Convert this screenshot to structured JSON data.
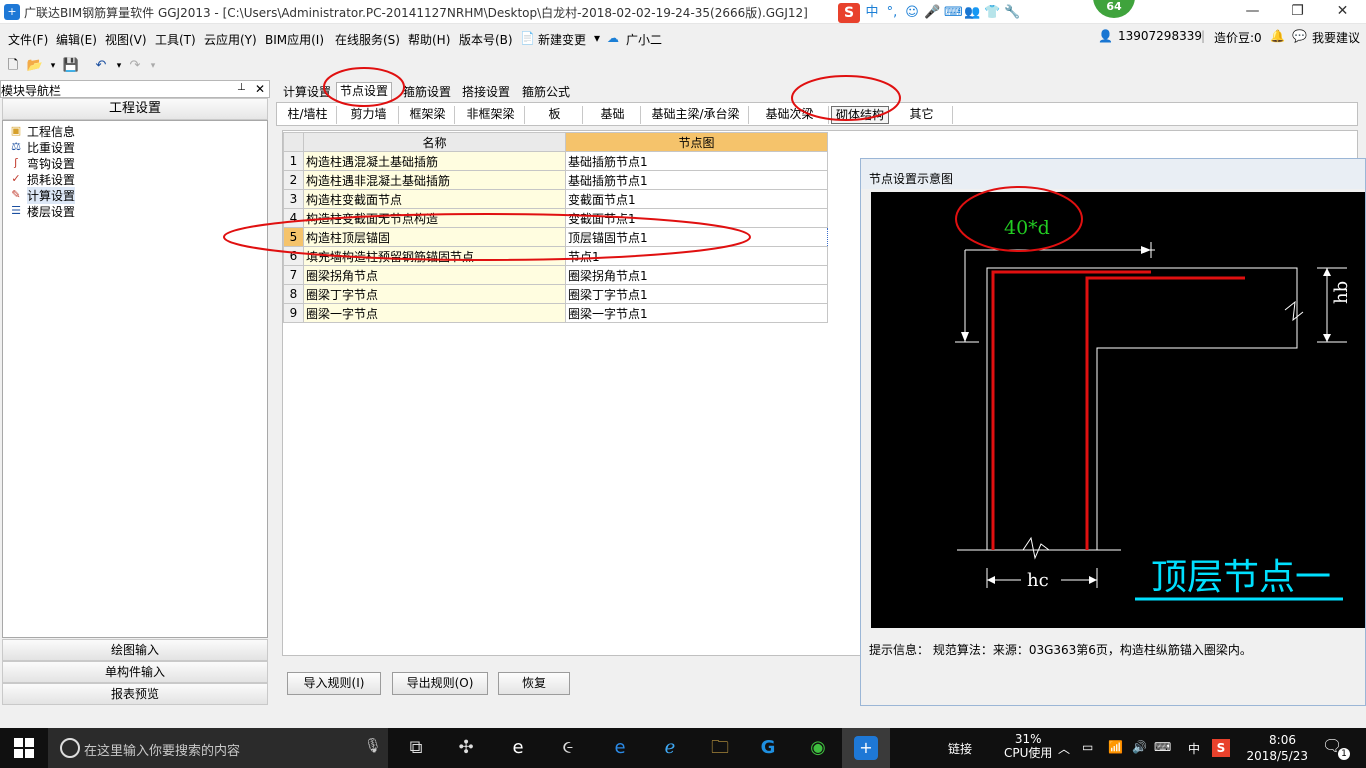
{
  "window": {
    "title": "广联达BIM钢筋算量软件 GGJ2013 - [C:\\Users\\Administrator.PC-20141127NRHM\\Desktop\\白龙村-2018-02-02-19-24-35(2666版).GGJ12]",
    "ime_logo": "S",
    "ime_mode": "中",
    "badge": "64"
  },
  "menu": {
    "items": [
      "文件(F)",
      "编辑(E)",
      "视图(V)",
      "工具(T)",
      "云应用(Y)",
      "BIM应用(I)",
      "在线服务(S)",
      "帮助(H)",
      "版本号(B)",
      "新建变更",
      "广小二"
    ],
    "phone": "13907298339",
    "price_beans": "造价豆:0",
    "suggest": "我要建议"
  },
  "nav": {
    "header": "模块导航栏",
    "pin": "📌",
    "close": "✕",
    "title": "工程设置",
    "tree": [
      {
        "label": "工程信息",
        "icon": "project-info-icon"
      },
      {
        "label": "比重设置",
        "icon": "density-icon"
      },
      {
        "label": "弯钩设置",
        "icon": "hook-icon"
      },
      {
        "label": "损耗设置",
        "icon": "loss-icon"
      },
      {
        "label": "计算设置",
        "icon": "calc-icon"
      },
      {
        "label": "楼层设置",
        "icon": "floor-icon"
      }
    ],
    "bottom": [
      "绘图输入",
      "单构件输入",
      "报表预览"
    ]
  },
  "tabs": [
    "计算设置",
    "节点设置",
    "箍筋设置",
    "搭接设置",
    "箍筋公式"
  ],
  "subtabs": [
    "柱/墙柱",
    "剪力墙",
    "框架梁",
    "非框架梁",
    "板",
    "基础",
    "基础主梁/承台梁",
    "基础次梁",
    "砌体结构",
    "其它"
  ],
  "grid": {
    "headers": [
      "名称",
      "节点图"
    ],
    "rows": [
      {
        "n": "1",
        "name": "构造柱遇混凝土基础插筋",
        "node": "基础插筋节点1"
      },
      {
        "n": "2",
        "name": "构造柱遇非混凝土基础插筋",
        "node": "基础插筋节点1"
      },
      {
        "n": "3",
        "name": "构造柱变截面节点",
        "node": "变截面节点1"
      },
      {
        "n": "4",
        "name": "构造柱变截面无节点构造",
        "node": "变截面节点1"
      },
      {
        "n": "5",
        "name": "构造柱顶层锚固",
        "node": "顶层锚固节点1"
      },
      {
        "n": "6",
        "name": "填充墙构造柱预留钢筋锚固节点",
        "node": "节点1"
      },
      {
        "n": "7",
        "name": "圈梁拐角节点",
        "node": "圈梁拐角节点1"
      },
      {
        "n": "8",
        "name": "圈梁丁字节点",
        "node": "圈梁丁字节点1"
      },
      {
        "n": "9",
        "name": "圈梁一字节点",
        "node": "圈梁一字节点1"
      }
    ]
  },
  "buttons": {
    "import": "导入规则(I)",
    "export": "导出规则(O)",
    "restore": "恢复"
  },
  "dialog": {
    "title": "节点设置示意图",
    "label_40d": "40*d",
    "label_hb": "hb",
    "label_hc": "hc",
    "caption": "顶层节点一",
    "info": "提示信息：  规范算法：来源：03G363第6页，构造柱纵筋锚入圈梁内。"
  },
  "taskbar": {
    "search_placeholder": "在这里输入你要搜索的内容",
    "link": "链接",
    "cpu_pct": "31%",
    "cpu_label": "CPU使用",
    "lang": "中",
    "time": "8:06",
    "date": "2018/5/23",
    "notif": "1"
  },
  "colors": {
    "highlight_orange": "#f5c36b",
    "annotation_red": "#e01010",
    "rebar_red": "#e01010",
    "caption_cyan": "#00e0ff",
    "label_green": "#22cc22"
  }
}
